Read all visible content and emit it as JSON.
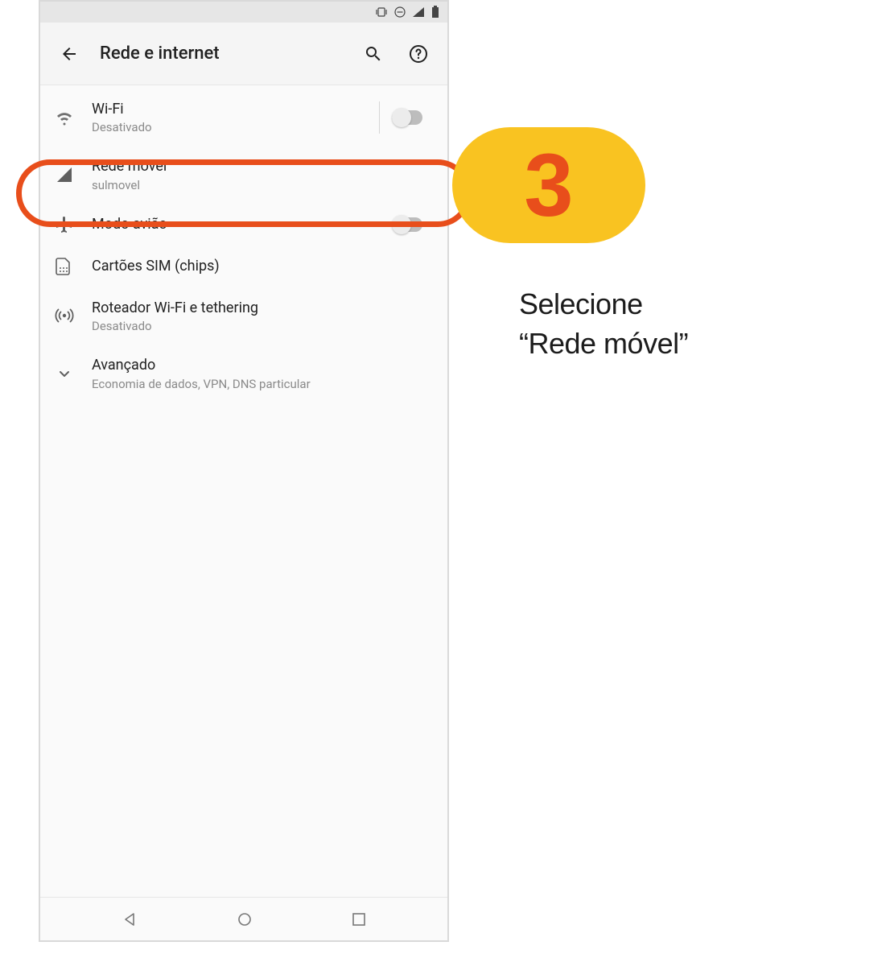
{
  "header": {
    "title": "Rede e internet"
  },
  "rows": {
    "wifi": {
      "title": "Wi-Fi",
      "sub": "Desativado"
    },
    "mobile": {
      "title": "Rede móvel",
      "sub": "sulmovel"
    },
    "airplane": {
      "title": "Modo avião"
    },
    "sim": {
      "title": "Cartões SIM (chips)"
    },
    "hotspot": {
      "title": "Roteador Wi-Fi e tethering",
      "sub": "Desativado"
    },
    "advanced": {
      "title": "Avançado",
      "sub": "Economia de dados, VPN, DNS particular"
    }
  },
  "callout": {
    "step": "3",
    "line1": "Selecione",
    "line2": "“Rede móvel”"
  }
}
